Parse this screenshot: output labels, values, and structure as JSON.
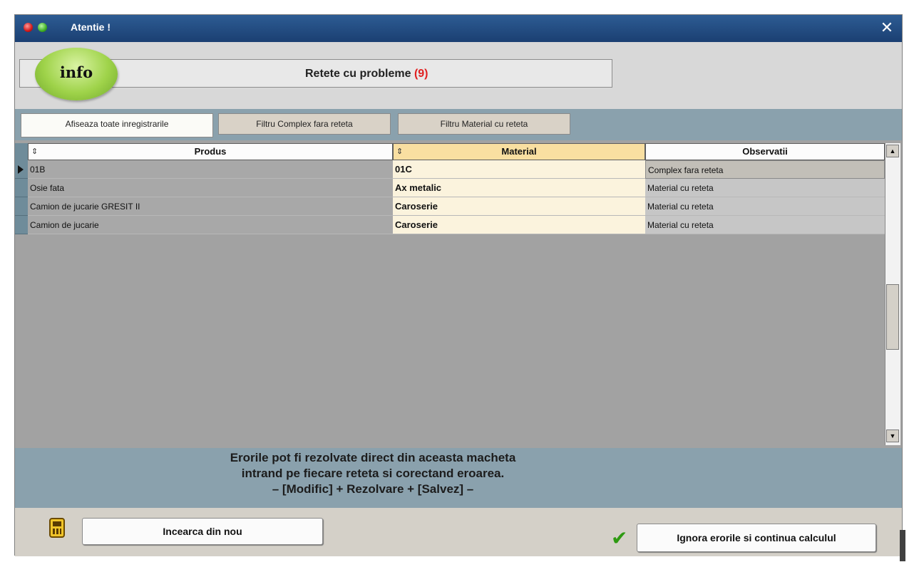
{
  "window": {
    "title": "Atentie !",
    "close_glyph": "✕"
  },
  "info": {
    "badge_text": "info",
    "message": "Retete cu probleme",
    "count": "(9)"
  },
  "tabs": [
    {
      "label": "Afiseaza toate inregistrarile",
      "active": true
    },
    {
      "label": "Filtru Complex fara reteta",
      "active": false
    },
    {
      "label": "Filtru Material cu reteta",
      "active": false
    }
  ],
  "grid": {
    "sort_glyph": "⇕",
    "columns": [
      "Produs",
      "Material",
      "Observatii"
    ],
    "rows": [
      {
        "produs": "01B",
        "material": "01C",
        "observatii": "Complex fara reteta"
      },
      {
        "produs": "Osie fata",
        "material": "Ax metalic",
        "observatii": "Material cu reteta"
      },
      {
        "produs": "Camion de jucarie GRESIT II",
        "material": "Caroserie",
        "observatii": "Material cu reteta"
      },
      {
        "produs": "Camion de jucarie",
        "material": "Caroserie",
        "observatii": "Material cu reteta"
      }
    ],
    "scroll_up_glyph": "▲",
    "scroll_down_glyph": "▼"
  },
  "hint": {
    "line1": "Erorile pot fi rezolvate direct din aceasta macheta",
    "line2": "intrand pe fiecare reteta si corectand eroarea.",
    "line3": "– [Modific] + Rezolvare + [Salvez] –"
  },
  "footer": {
    "retry_label": "Incearca din nou",
    "ignore_label": "Ignora erorile si continua calculul",
    "check_glyph": "✔"
  },
  "colors": {
    "titlebar": "#1b3f72",
    "panel": "#8aa1ad",
    "count": "#e02020",
    "material_cell": "#fbf3dd",
    "check": "#2e9a12"
  }
}
